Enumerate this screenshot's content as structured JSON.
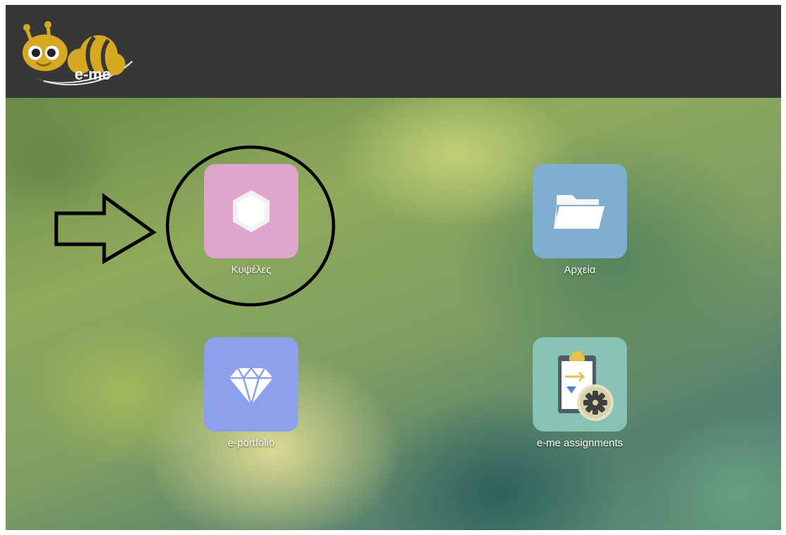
{
  "header": {
    "logo_text": "e-me",
    "background_color": "#373737"
  },
  "apps": [
    {
      "label": "Κυψέλες",
      "icon": "hexagon-icon",
      "color": "#dea6cc"
    },
    {
      "label": "Αρχεία",
      "icon": "folder-icon",
      "color": "#7faed1"
    },
    {
      "label": "e-portfolio",
      "icon": "diamond-icon",
      "color": "#8ca0ec"
    },
    {
      "label": "e-me assignments",
      "icon": "clipboard-gear-icon",
      "color": "#88c2b5"
    }
  ],
  "annotation": {
    "arrow": "right-arrow-outline",
    "circle": "highlight-circle",
    "target": "Κυψέλες"
  }
}
